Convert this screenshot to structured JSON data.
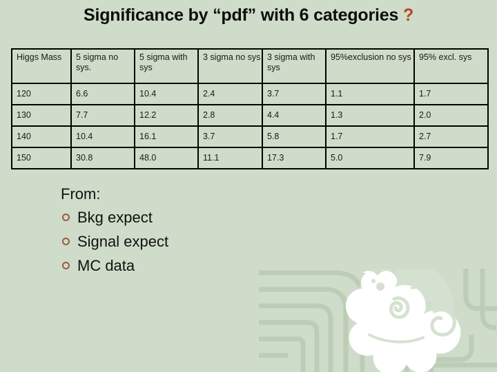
{
  "slide": {
    "title_main": "Significance by “pdf” with 6 categories",
    "title_qmark": "?",
    "background_color": "#cfdcc9",
    "accent_color": "#b5462a",
    "sys_value_color": "#4e76a8"
  },
  "table": {
    "headers": [
      "Higgs Mass",
      "5 sigma no sys.",
      "5 sigma with sys",
      "3 sigma no sys",
      "3 sigma with sys",
      "95%exclusion no sys",
      "95% excl. sys"
    ],
    "rows": [
      {
        "mass": "120",
        "five_sigma_no_sys": "6.6",
        "five_sigma_with_sys": "10.4",
        "three_sigma_no_sys": "2.4",
        "three_sigma_with_sys": "3.7",
        "excl95_no_sys": "1.1",
        "excl95_sys": "1.7"
      },
      {
        "mass": "130",
        "five_sigma_no_sys": "7.7",
        "five_sigma_with_sys": "12.2",
        "three_sigma_no_sys": "2.8",
        "three_sigma_with_sys": "4.4",
        "excl95_no_sys": "1.3",
        "excl95_sys": "2.0"
      },
      {
        "mass": "140",
        "five_sigma_no_sys": "10.4",
        "five_sigma_with_sys": "16.1",
        "three_sigma_no_sys": "3.7",
        "three_sigma_with_sys": "5.8",
        "excl95_no_sys": "1.7",
        "excl95_sys": "2.7"
      },
      {
        "mass": "150",
        "five_sigma_no_sys": "30.8",
        "five_sigma_with_sys": "48.0",
        "three_sigma_no_sys": "11.1",
        "three_sigma_with_sys": "17.3",
        "excl95_no_sys": "5.0",
        "excl95_sys": "7.9"
      }
    ]
  },
  "from_block": {
    "label": "From:",
    "items": [
      "Bkg expect",
      "Signal expect",
      "MC data"
    ]
  },
  "decoration": {
    "watermark_name": "dragon-phoenix-watermark"
  }
}
